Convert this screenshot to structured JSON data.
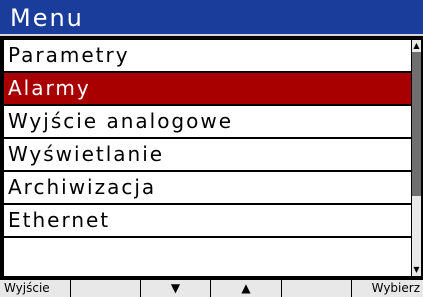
{
  "title": "Menu",
  "menu": {
    "items": [
      {
        "label": "Parametry",
        "selected": false
      },
      {
        "label": "Alarmy",
        "selected": true
      },
      {
        "label": "Wyjście analogowe",
        "selected": false
      },
      {
        "label": "Wyświetlanie",
        "selected": false
      },
      {
        "label": "Archiwizacja",
        "selected": false
      },
      {
        "label": "Ethernet",
        "selected": false
      }
    ]
  },
  "scrollbar": {
    "up_icon": "arrow-up-icon",
    "down_icon": "arrow-down-icon",
    "up_glyph": "▲",
    "down_glyph": "▼",
    "thumb_start_fraction": 0.0,
    "thumb_end_fraction": 0.68
  },
  "softkeys": [
    {
      "label": "Wyjście",
      "name": "exit"
    },
    {
      "label": "",
      "name": "blank"
    },
    {
      "label": "▼",
      "name": "down"
    },
    {
      "label": "▲",
      "name": "up"
    },
    {
      "label": "",
      "name": "blank2"
    },
    {
      "label": "Wybierz",
      "name": "select"
    }
  ],
  "colors": {
    "titlebar": "#1a3c9a",
    "selection": "#a80000",
    "background": "#ffffff"
  }
}
